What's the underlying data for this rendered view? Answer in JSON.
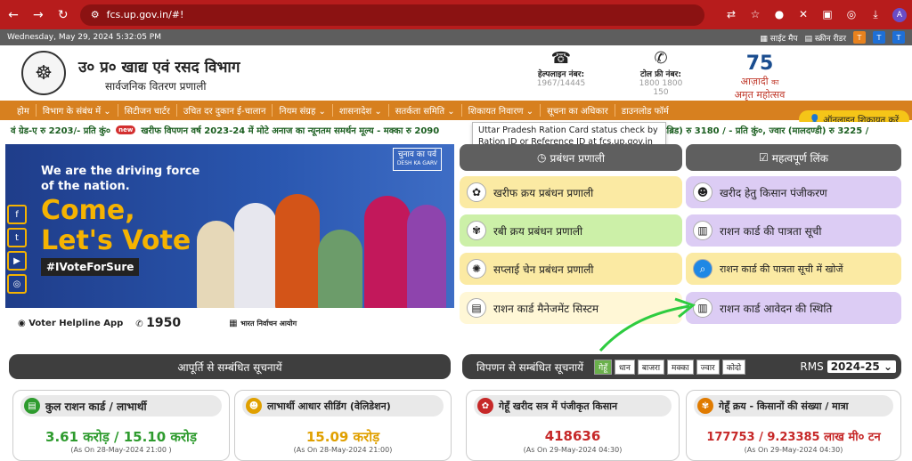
{
  "browser": {
    "url": "fcs.up.gov.in/#!",
    "avatar_letter": "A"
  },
  "topbar": {
    "datetime": "Wednesday, May 29, 2024 5:32:05 PM",
    "sitemap": "साईट मैप",
    "screen_reader": "स्क्रीन रीडर",
    "font_buttons": [
      "T",
      "T",
      "T"
    ]
  },
  "header": {
    "title": "उ० प्र० खाद्य एवं रसद विभाग",
    "subtitle": "सार्वजनिक वितरण प्रणाली",
    "helpline_label": "हेल्पलाइन नंबर:",
    "helpline_number": "1967/14445",
    "tollfree_label": "टोल फ्री नंबर:",
    "tollfree_number": "1800 1800 150",
    "azadi_line1": "आज़ादी",
    "azadi_line2": "का",
    "azadi_line3": "अमृत महोत्सव",
    "azadi_seventy": "75"
  },
  "menu": {
    "items": [
      "होम",
      "विभाग के संबंध में ⌄",
      "सिटीजन चार्टर",
      "उचित दर दुकान ई-चालान",
      "नियम संग्रह ⌄",
      "शासनादेश ⌄",
      "सतर्कता समिति ⌄",
      "शिकायत निवारण ⌄",
      "सूचना का अधिकार",
      "डाउनलोड फॉर्म"
    ],
    "complaint_button": "ऑनलाइन शिकायत करें"
  },
  "ticker": {
    "left_text": "वं ग्रेड-ए रु 2203/- प्रति कुं०",
    "new_badge": "new",
    "main_text": "खरीफ विपणन वर्ष 2023-24 में मोटे अनाज का न्यूनतम समर्थन मूल्य - मक्का रु 2090",
    "right_text": "(हाइब्रिड) रु 3180 / - प्रति कुं०, ज्वार (मालदण्डी) रु 3225 /"
  },
  "tooltip": {
    "text": "Uttar Pradesh Ration Card status check by Ration ID or Reference ID at fcs.up.gov.in"
  },
  "banner": {
    "line1": "We are the driving force of the nation.",
    "line2a": "Come,",
    "line2b": "Let's Vote",
    "hashtag": "#IVoteForSure",
    "chunav_hindi": "चुनाव का पर्व",
    "chunav_en": "DESH KA GARV",
    "voter_app_small": "Download • Register • Check • Participate",
    "voter_app": "Voter Helpline App",
    "helpline_small": "Call Voter Helpline",
    "helpline_num": "1950",
    "eci_hindi": "भारत निर्वाचन आयोग",
    "eci_en": "Election Comission of India"
  },
  "pravandhan": {
    "heading": "प्रबंधन प्रणाली",
    "items": [
      "खरीफ क्रय प्रबंधन प्रणाली",
      "रबी क्रय प्रबंधन प्रणाली",
      "सप्लाई चेन प्रबंधन प्रणाली",
      "राशन कार्ड मैनेजमेंट सिस्टम"
    ]
  },
  "important_links": {
    "heading": "महत्वपूर्ण लिंक",
    "items": [
      "खरीद हेतु किसान पंजीकरण",
      "राशन कार्ड की पात्रता सूची",
      "राशन कार्ड की पात्रता सूची में खोजें",
      "राशन कार्ड आवेदन की स्थिति"
    ]
  },
  "supply_section": {
    "heading": "आपूर्ति से सम्बंधित सूचनायें"
  },
  "marketing_section": {
    "heading": "विपणन से सम्बंधित सूचनायें",
    "chips": [
      "गेहूँ",
      "धान",
      "बाजरा",
      "मक्का",
      "ज्वार",
      "कोदो"
    ],
    "rms_label": "RMS",
    "rms_value": "2024-25 ⌄"
  },
  "cards": [
    {
      "title": "कुल राशन कार्ड / लाभार्थी",
      "value": "3.61 करोड़ / 15.10 करोड़",
      "date": "(As On 28-May-2024 21:00 )",
      "color": "#2e9b2e"
    },
    {
      "title": "लाभार्थी आधार सीडिंग (वेलिडेशन)",
      "value": "15.09 करोड़",
      "date": "(As On 28-May-2024 21:00)",
      "color": "#e0a000"
    },
    {
      "title": "गेहूँ खरीद सत्र में पंजीकृत किसान",
      "value": "418636",
      "date": "(As On 29-May-2024 04:30)",
      "color": "#c62828"
    },
    {
      "title": "गेहूँ क्रय - किसानों की संख्या / मात्रा",
      "value": "177753 / 9.23385 लाख मी० टन",
      "date": "(As On 29-May-2024 04:30)",
      "color": "#c62828"
    }
  ]
}
